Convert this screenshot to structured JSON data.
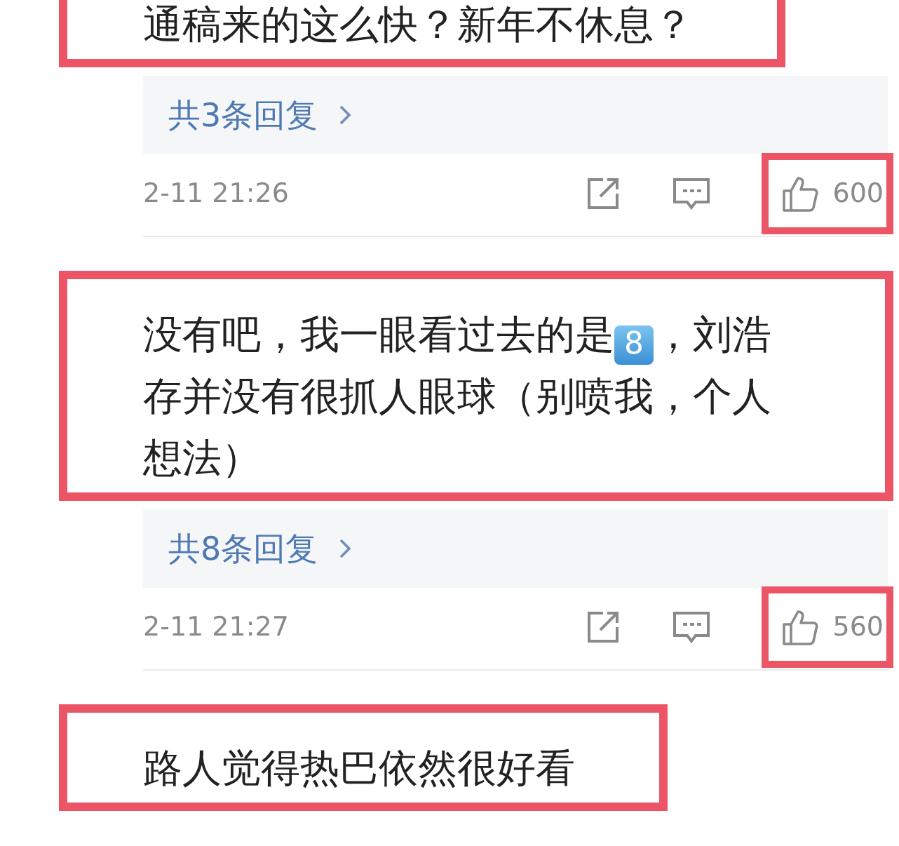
{
  "comments": [
    {
      "text": [
        {
          "kind": "text",
          "value": "通稿来的这么快？新年不休息？"
        }
      ],
      "highlighted": true,
      "replies": "共3条回复",
      "time": "2-11 21:26",
      "likes": "600",
      "likes_highlighted": true
    },
    {
      "text": [
        {
          "kind": "text",
          "value": "没有吧，我一眼看过去的是"
        },
        {
          "kind": "keycap",
          "value": "8"
        },
        {
          "kind": "text",
          "value": "，刘浩存并没有很抓人眼球（别喷我，个人想法）"
        }
      ],
      "highlighted": true,
      "replies": "共8条回复",
      "time": "2-11 21:27",
      "likes": "560",
      "likes_highlighted": true
    },
    {
      "text": [
        {
          "kind": "text",
          "value": "路人觉得热巴依然很好看"
        }
      ],
      "highlighted": true
    }
  ]
}
